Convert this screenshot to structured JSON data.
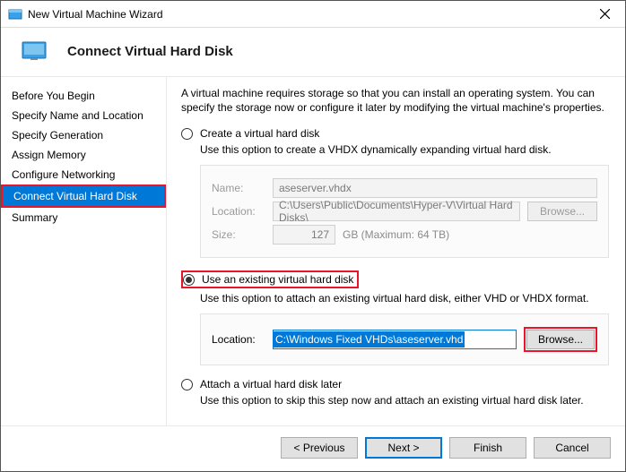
{
  "window": {
    "title": "New Virtual Machine Wizard"
  },
  "header": {
    "title": "Connect Virtual Hard Disk"
  },
  "sidebar": {
    "items": [
      {
        "label": "Before You Begin"
      },
      {
        "label": "Specify Name and Location"
      },
      {
        "label": "Specify Generation"
      },
      {
        "label": "Assign Memory"
      },
      {
        "label": "Configure Networking"
      },
      {
        "label": "Connect Virtual Hard Disk"
      },
      {
        "label": "Summary"
      }
    ]
  },
  "main": {
    "intro": "A virtual machine requires storage so that you can install an operating system. You can specify the storage now or configure it later by modifying the virtual machine's properties.",
    "opt1": {
      "label": "Create a virtual hard disk",
      "desc": "Use this option to create a VHDX dynamically expanding virtual hard disk.",
      "name_label": "Name:",
      "name_value": "aseserver.vhdx",
      "loc_label": "Location:",
      "loc_value": "C:\\Users\\Public\\Documents\\Hyper-V\\Virtual Hard Disks\\",
      "browse": "Browse...",
      "size_label": "Size:",
      "size_value": "127",
      "size_suffix": "GB (Maximum: 64 TB)"
    },
    "opt2": {
      "label": "Use an existing virtual hard disk",
      "desc": "Use this option to attach an existing virtual hard disk, either VHD or VHDX format.",
      "loc_label": "Location:",
      "loc_value": "C:\\Windows Fixed VHDs\\aseserver.vhd",
      "browse": "Browse..."
    },
    "opt3": {
      "label": "Attach a virtual hard disk later",
      "desc": "Use this option to skip this step now and attach an existing virtual hard disk later."
    }
  },
  "footer": {
    "previous": "< Previous",
    "next": "Next >",
    "finish": "Finish",
    "cancel": "Cancel"
  }
}
